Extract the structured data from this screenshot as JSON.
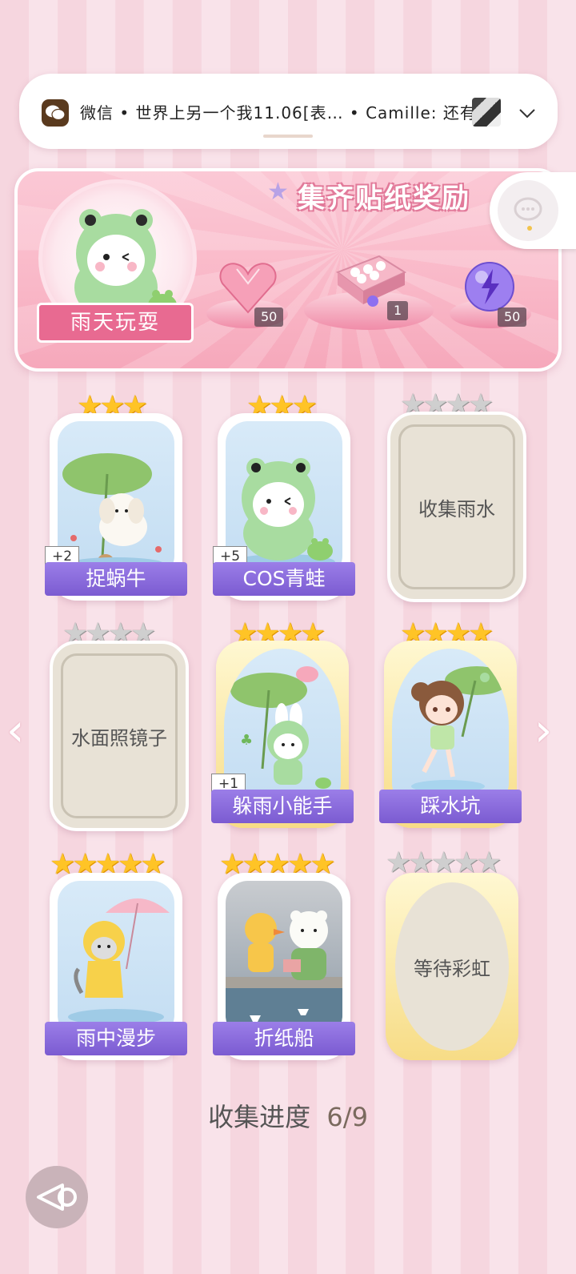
{
  "notification": {
    "app_name": "微信",
    "message": "微信 • 世界上另一个我11.06[表… • Camille: 还有…",
    "expand_icon": "chevron-down-icon"
  },
  "banner": {
    "title": "集齐贴纸奖励",
    "theme_name": "雨天玩耍",
    "rewards": [
      {
        "icon": "pink-heart-gem-icon",
        "count": "50"
      },
      {
        "icon": "gift-box-icon",
        "count": "1"
      },
      {
        "icon": "purple-lightning-orb-icon",
        "count": "50"
      }
    ]
  },
  "cards": [
    {
      "label": "捉蜗牛",
      "bonus": "+2",
      "stars": 3,
      "collected": true
    },
    {
      "label": "COS青蛙",
      "bonus": "+5",
      "stars": 3,
      "collected": true
    },
    {
      "label": "收集雨水",
      "stars": 4,
      "collected": false
    },
    {
      "label": "水面照镜子",
      "stars": 4,
      "collected": false
    },
    {
      "label": "躲雨小能手",
      "bonus": "+1",
      "stars": 4,
      "collected": true
    },
    {
      "label": "踩水坑",
      "stars": 4,
      "collected": true
    },
    {
      "label": "雨中漫步",
      "stars": 5,
      "collected": true
    },
    {
      "label": "折纸船",
      "stars": 5,
      "collected": true
    },
    {
      "label": "等待彩虹",
      "stars": 5,
      "collected": false
    }
  ],
  "progress": {
    "label": "收集进度",
    "value": "6/9"
  },
  "colors": {
    "accent": "#7b5bd1",
    "pink": "#e86a91",
    "gold": "#ffc426"
  }
}
